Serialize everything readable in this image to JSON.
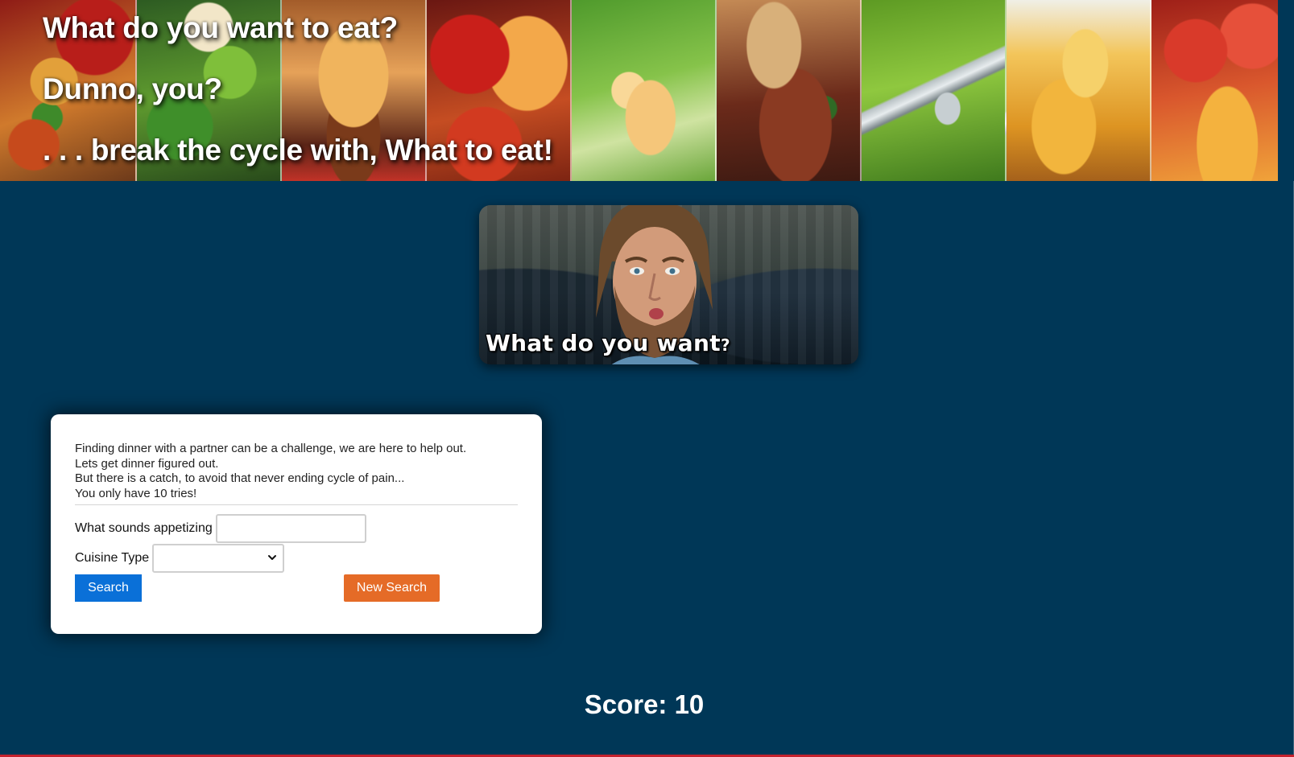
{
  "hero": {
    "line1": "What do you want to eat?",
    "line2": "Dunno, you?",
    "line3": ". . . break the cycle with, What to eat!"
  },
  "meme": {
    "caption": "What do you want",
    "caption_mark": "?"
  },
  "form": {
    "intro": [
      "Finding dinner with a partner can be a challenge, we are here to help out.",
      "Lets get dinner figured out.",
      "But there is a catch, to avoid that never ending cycle of pain...",
      "You only have 10 tries!"
    ],
    "appetizing_label": "What sounds appetizing",
    "appetizing_value": "",
    "cuisine_label": "Cuisine Type",
    "cuisine_selected": "",
    "search_label": "Search",
    "new_search_label": "New Search"
  },
  "score": {
    "text": "Score: 10"
  },
  "colors": {
    "background": "#003757",
    "search_button": "#0a70d8",
    "new_search_button": "#e56b27",
    "bottom_rule": "#c4222d"
  },
  "icons": {
    "select_arrow": "chevron-down-icon"
  }
}
